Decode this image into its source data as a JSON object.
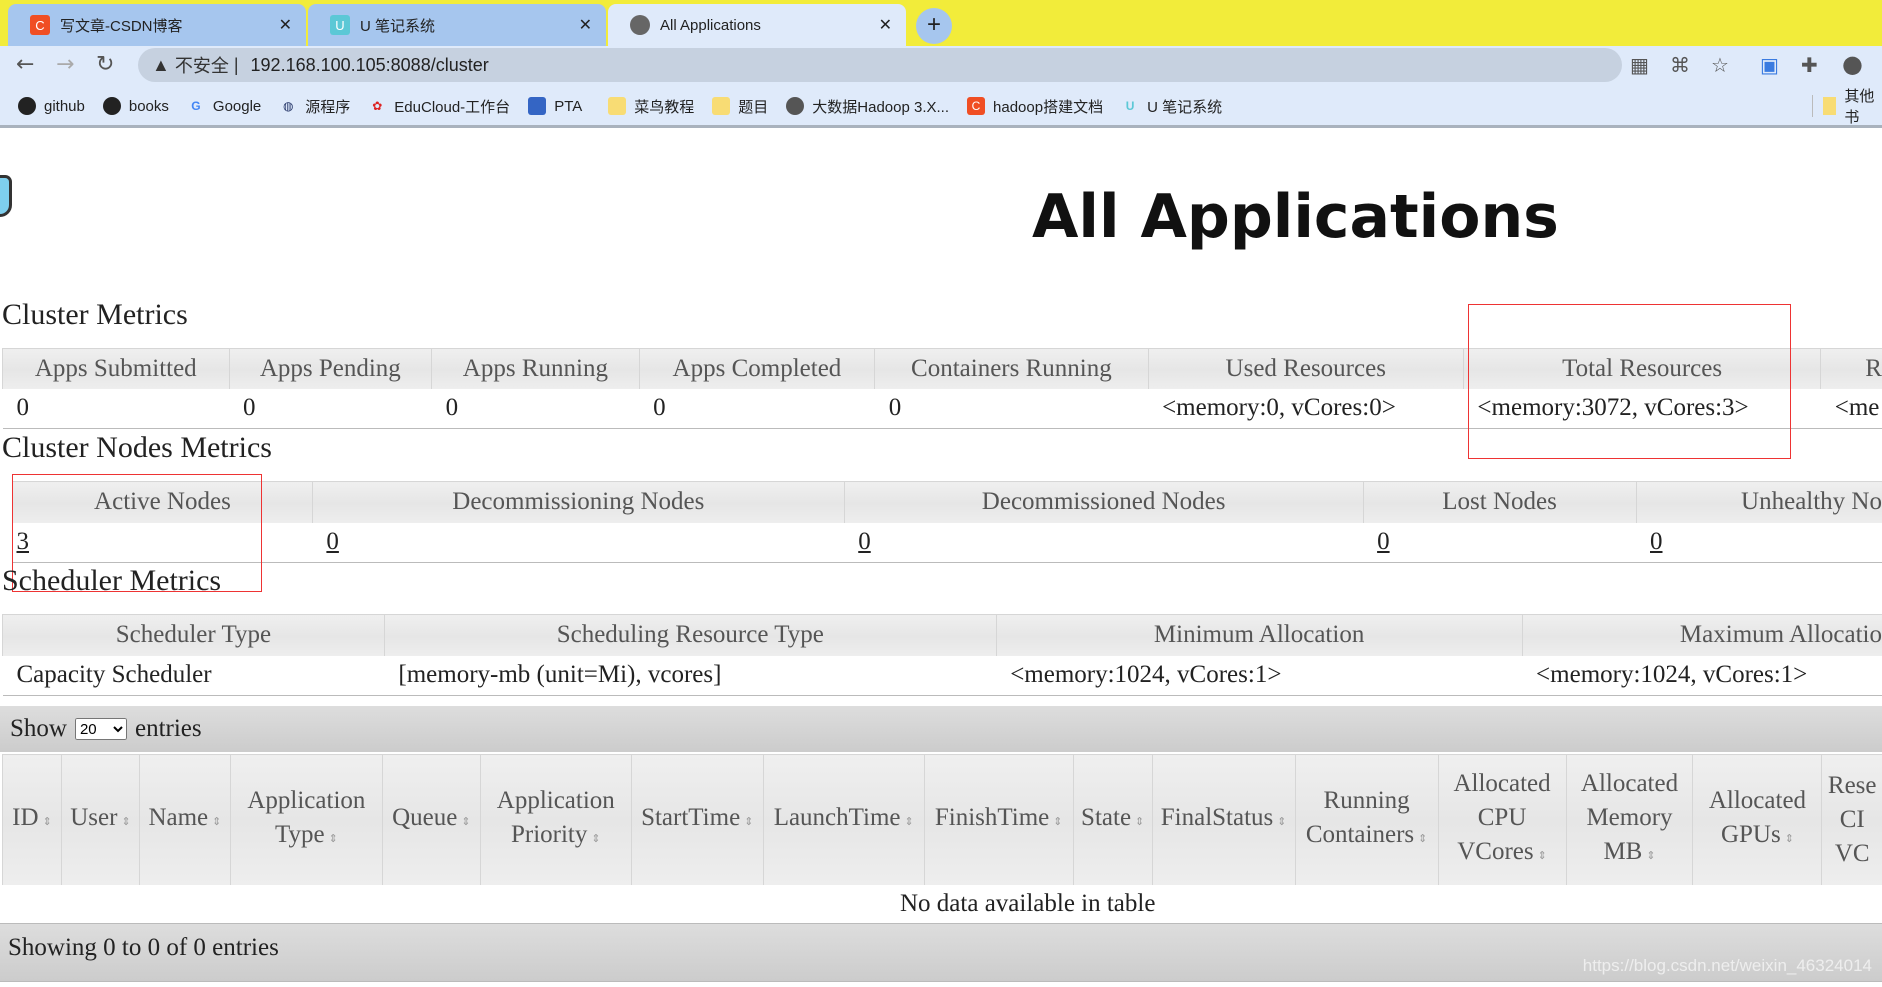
{
  "browser": {
    "tabs": [
      {
        "label": "写文章-CSDN博客",
        "active": false
      },
      {
        "label": "U 笔记系统",
        "active": false
      },
      {
        "label": "All Applications",
        "active": true
      }
    ],
    "security": "不安全",
    "url": "192.168.100.105:8088/cluster",
    "bookmarks": [
      "github",
      "books",
      "Google",
      "源程序",
      "EduCloud-工作台",
      "PTA",
      "菜鸟教程",
      "题目",
      "大数据Hadoop 3.X...",
      "hadoop搭建文档",
      "U 笔记系统"
    ],
    "other_bookmarks": "其他书"
  },
  "page": {
    "title": "All Applications"
  },
  "cluster_metrics": {
    "title": "Cluster Metrics",
    "headers": [
      "Apps Submitted",
      "Apps Pending",
      "Apps Running",
      "Apps Completed",
      "Containers Running",
      "Used Resources",
      "Total Resources",
      "R"
    ],
    "values": [
      "0",
      "0",
      "0",
      "0",
      "0",
      "<memory:0, vCores:0>",
      "<memory:3072, vCores:3>",
      "<me"
    ]
  },
  "nodes_metrics": {
    "title": "Cluster Nodes Metrics",
    "headers": [
      "Active Nodes",
      "Decommissioning Nodes",
      "Decommissioned Nodes",
      "Lost Nodes",
      "Unhealthy No"
    ],
    "values": [
      "3",
      "0",
      "0",
      "0",
      "0"
    ]
  },
  "scheduler_metrics": {
    "title": "Scheduler Metrics",
    "headers": [
      "Scheduler Type",
      "Scheduling Resource Type",
      "Minimum Allocation",
      "Maximum Allocatio"
    ],
    "values": [
      "Capacity Scheduler",
      "[memory-mb (unit=Mi), vcores]",
      "<memory:1024, vCores:1>",
      "<memory:1024, vCores:1>"
    ]
  },
  "apps_table": {
    "show_label": "Show",
    "entries_label": "entries",
    "page_size": "20",
    "columns": [
      "ID",
      "User",
      "Name",
      "Application Type",
      "Queue",
      "Application Priority",
      "StartTime",
      "LaunchTime",
      "FinishTime",
      "State",
      "FinalStatus",
      "Running Containers",
      "Allocated CPU VCores",
      "Allocated Memory MB",
      "Allocated GPUs",
      "Rese CI VC"
    ],
    "empty": "No data available in table",
    "info": "Showing 0 to 0 of 0 entries"
  },
  "watermark": "https://blog.csdn.net/weixin_46324014"
}
